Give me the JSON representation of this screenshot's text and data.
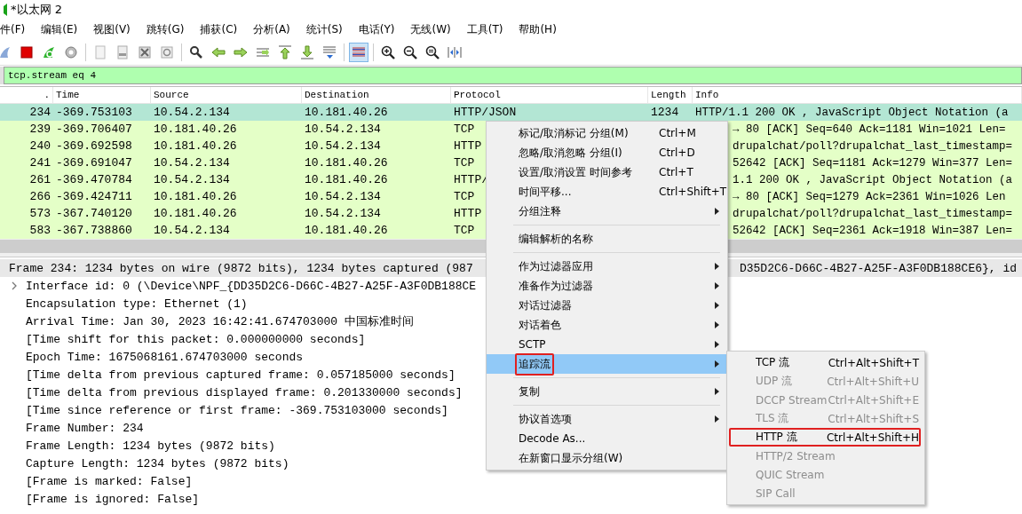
{
  "window": {
    "title": "*以太网 2"
  },
  "menubar": [
    "件(F)",
    "编辑(E)",
    "视图(V)",
    "跳转(G)",
    "捕获(C)",
    "分析(A)",
    "统计(S)",
    "电话(Y)",
    "无线(W)",
    "工具(T)",
    "帮助(H)"
  ],
  "toolbar": [
    {
      "pressed": false
    },
    {
      "pressed": false
    },
    {
      "pressed": false
    },
    {
      "pressed": false
    },
    {
      "pressed": false
    },
    {
      "pressed": false
    },
    {
      "pressed": false
    },
    {
      "pressed": false
    },
    {
      "pressed": false
    },
    {
      "pressed": false
    },
    {
      "pressed": false
    },
    {
      "pressed": false
    },
    {
      "pressed": false
    },
    {
      "pressed": false
    },
    {
      "pressed": false
    },
    {
      "pressed": true
    },
    {
      "pressed": false
    },
    {
      "pressed": false
    },
    {
      "pressed": false
    },
    {
      "pressed": false
    }
  ],
  "filter": {
    "value": "tcp.stream eq 4"
  },
  "packet_list": {
    "columns": [
      ".",
      "Time",
      "Source",
      "Destination",
      "Protocol",
      "Length",
      "Info"
    ],
    "rows": [
      {
        "selected": true,
        "no": "234",
        "time": "-369.753103",
        "source": "10.54.2.134",
        "destination": "10.181.40.26",
        "protocol": "HTTP/JSON",
        "length": "1234",
        "info": "HTTP/1.1 200 OK , JavaScript Object Notation (a"
      },
      {
        "selected": false,
        "no": "239",
        "time": "-369.706407",
        "source": "10.181.40.26",
        "destination": "10.54.2.134",
        "protocol": "TCP",
        "info": "→ 80 [ACK] Seq=640 Ack=1181 Win=1021 Len="
      },
      {
        "selected": false,
        "no": "240",
        "time": "-369.692598",
        "source": "10.181.40.26",
        "destination": "10.54.2.134",
        "protocol": "HTTP",
        "info": "drupalchat/poll?drupalchat_last_timestamp="
      },
      {
        "selected": false,
        "no": "241",
        "time": "-369.691047",
        "source": "10.54.2.134",
        "destination": "10.181.40.26",
        "protocol": "TCP",
        "info": "52642 [ACK] Seq=1181 Ack=1279 Win=377 Len="
      },
      {
        "selected": false,
        "no": "261",
        "time": "-369.470784",
        "source": "10.54.2.134",
        "destination": "10.181.40.26",
        "protocol": "HTTP/",
        "info": "1.1 200 OK , JavaScript Object Notation (a"
      },
      {
        "selected": false,
        "no": "266",
        "time": "-369.424711",
        "source": "10.181.40.26",
        "destination": "10.54.2.134",
        "protocol": "TCP",
        "info": "→ 80 [ACK] Seq=1279 Ack=2361 Win=1026 Len"
      },
      {
        "selected": false,
        "no": "573",
        "time": "-367.740120",
        "source": "10.181.40.26",
        "destination": "10.54.2.134",
        "protocol": "HTTP",
        "info": "drupalchat/poll?drupalchat_last_timestamp="
      },
      {
        "selected": false,
        "no": "583",
        "time": "-367.738860",
        "source": "10.54.2.134",
        "destination": "10.181.40.26",
        "protocol": "TCP",
        "info": "52642 [ACK] Seq=2361 Ack=1918 Win=387 Len="
      }
    ]
  },
  "details": {
    "label": "Frame 234: 1234 bytes on wire (9872 bits), 1234 bytes captured (987",
    "label_tail": "D35D2C6-D66C-4B27-A25F-A3F0DB188CE6}, id",
    "selected": true,
    "children": [
      {
        "label": "Interface id: 0 (\\Device\\NPF_{DD35D2C6-D66C-4B27-A25F-A3F0DB188CE",
        "expandable": true
      },
      {
        "label": "Encapsulation type: Ethernet (1)",
        "expandable": false
      },
      {
        "label": "Arrival Time: Jan 30, 2023 16:42:41.674703000 中国标准时间",
        "expandable": false
      },
      {
        "label": "[Time shift for this packet: 0.000000000 seconds]",
        "expandable": false
      },
      {
        "label": "Epoch Time: 1675068161.674703000 seconds",
        "expandable": false
      },
      {
        "label": "[Time delta from previous captured frame: 0.057185000 seconds]",
        "expandable": false
      },
      {
        "label": "[Time delta from previous displayed frame: 0.201330000 seconds]",
        "expandable": false
      },
      {
        "label": "[Time since reference or first frame: -369.753103000 seconds]",
        "expandable": false
      },
      {
        "label": "Frame Number: 234",
        "expandable": false
      },
      {
        "label": "Frame Length: 1234 bytes (9872 bits)",
        "expandable": false
      },
      {
        "label": "Capture Length: 1234 bytes (9872 bits)",
        "expandable": false
      },
      {
        "label": "[Frame is marked: False]",
        "expandable": false
      },
      {
        "label": "[Frame is ignored: False]",
        "expandable": false
      }
    ]
  },
  "context_menu": {
    "items": [
      {
        "kind": "item",
        "label": "标记/取消标记 分组(M)",
        "shortcut": "Ctrl+M",
        "submenu": false,
        "selected": false,
        "outlined": false
      },
      {
        "kind": "item",
        "label": "忽略/取消忽略 分组(I)",
        "shortcut": "Ctrl+D",
        "submenu": false,
        "selected": false,
        "outlined": false
      },
      {
        "kind": "item",
        "label": "设置/取消设置 时间参考",
        "shortcut": "Ctrl+T",
        "submenu": false,
        "selected": false,
        "outlined": false
      },
      {
        "kind": "item",
        "label": "时间平移...",
        "shortcut": "Ctrl+Shift+T",
        "submenu": false,
        "selected": false,
        "outlined": false
      },
      {
        "kind": "item",
        "label": "分组注释",
        "submenu": true,
        "selected": false,
        "outlined": false
      },
      {
        "kind": "separator"
      },
      {
        "kind": "item",
        "label": "编辑解析的名称",
        "submenu": false,
        "selected": false,
        "outlined": false
      },
      {
        "kind": "separator"
      },
      {
        "kind": "item",
        "label": "作为过滤器应用",
        "submenu": true,
        "selected": false,
        "outlined": false
      },
      {
        "kind": "item",
        "label": "准备作为过滤器",
        "submenu": true,
        "selected": false,
        "outlined": false
      },
      {
        "kind": "item",
        "label": "对话过滤器",
        "submenu": true,
        "selected": false,
        "outlined": false
      },
      {
        "kind": "item",
        "label": "对话着色",
        "submenu": true,
        "selected": false,
        "outlined": false
      },
      {
        "kind": "item",
        "label": "SCTP",
        "submenu": true,
        "selected": false,
        "outlined": false
      },
      {
        "kind": "item",
        "label": "追踪流",
        "submenu": true,
        "selected": true,
        "outlined": true
      },
      {
        "kind": "separator"
      },
      {
        "kind": "item",
        "label": "复制",
        "submenu": true,
        "selected": false,
        "outlined": false
      },
      {
        "kind": "separator"
      },
      {
        "kind": "item",
        "label": "协议首选项",
        "submenu": true,
        "selected": false,
        "outlined": false
      },
      {
        "kind": "item",
        "label": "Decode As...",
        "submenu": false,
        "selected": false,
        "outlined": false
      },
      {
        "kind": "item",
        "label": "在新窗口显示分组(W)",
        "submenu": false,
        "selected": false,
        "outlined": false
      }
    ]
  },
  "submenu": {
    "items": [
      {
        "label": "TCP 流",
        "shortcut": "Ctrl+Alt+Shift+T",
        "disabled": false,
        "outlined": false
      },
      {
        "label": "UDP 流",
        "shortcut": "Ctrl+Alt+Shift+U",
        "disabled": true,
        "outlined": false
      },
      {
        "label": "DCCP Stream",
        "shortcut": "Ctrl+Alt+Shift+E",
        "disabled": true,
        "outlined": false
      },
      {
        "label": "TLS 流",
        "shortcut": "Ctrl+Alt+Shift+S",
        "disabled": true,
        "outlined": false
      },
      {
        "label": "HTTP 流",
        "shortcut": "Ctrl+Alt+Shift+H",
        "disabled": false,
        "outlined": true
      },
      {
        "label": "HTTP/2 Stream",
        "disabled": true,
        "outlined": false
      },
      {
        "label": "QUIC Stream",
        "disabled": true,
        "outlined": false
      },
      {
        "label": "SIP Call",
        "disabled": true,
        "outlined": false
      }
    ]
  }
}
